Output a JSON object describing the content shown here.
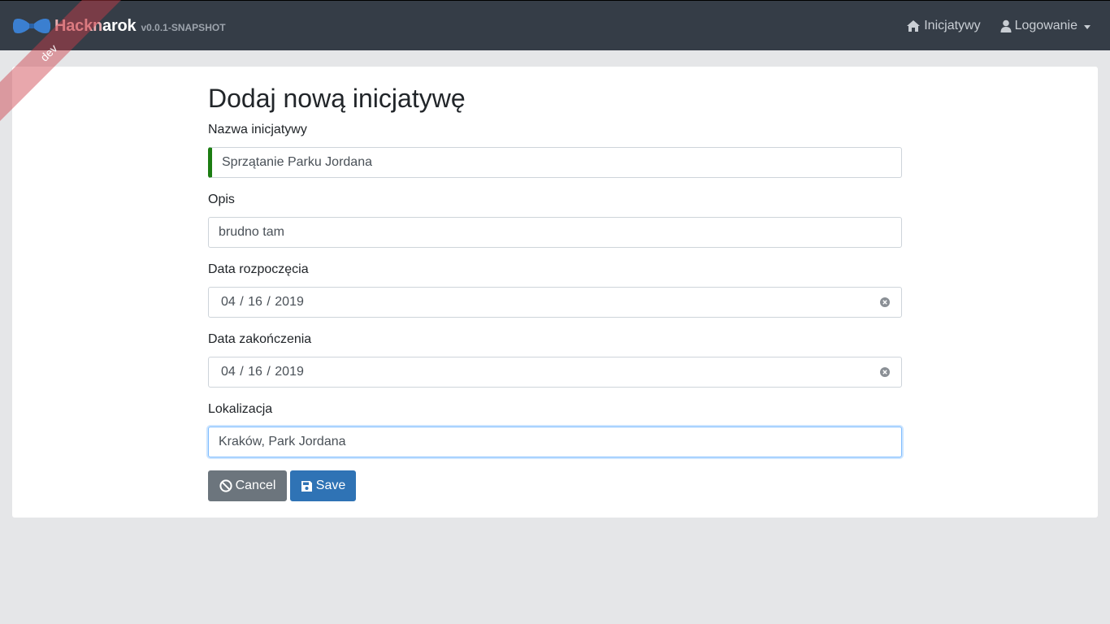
{
  "navbar": {
    "brand_part1": "Hackn",
    "brand_part2": "arok",
    "version": "v0.0.1-SNAPSHOT",
    "links": [
      {
        "label": "Inicjatywy",
        "icon": "home-icon"
      },
      {
        "label": "Logowanie",
        "icon": "user-icon"
      }
    ]
  },
  "ribbon": {
    "label": "dev"
  },
  "form": {
    "title": "Dodaj nową inicjatywę",
    "fields": {
      "name": {
        "label": "Nazwa inicjatywy",
        "value": "Sprzątanie Parku Jordana"
      },
      "description": {
        "label": "Opis",
        "value": "brudno tam"
      },
      "start_date": {
        "label": "Data rozpoczęcia",
        "value": "04 / 16 / 2019"
      },
      "end_date": {
        "label": "Data zakończenia",
        "value": "04 / 16 / 2019"
      },
      "location": {
        "label": "Lokalizacja",
        "value": "Kraków, Park Jordana"
      }
    },
    "buttons": {
      "cancel": {
        "label": "Cancel",
        "icon": "ban-icon"
      },
      "save": {
        "label": "Save",
        "icon": "floppy-disk-icon"
      }
    }
  },
  "colors": {
    "navbar_bg": "#353d47",
    "page_bg": "#e5e6e8",
    "valid_marker": "#1c7d12",
    "cancel_button": "#6c757d",
    "save_button": "#2f73b5",
    "focus_border": "#80bdff"
  }
}
